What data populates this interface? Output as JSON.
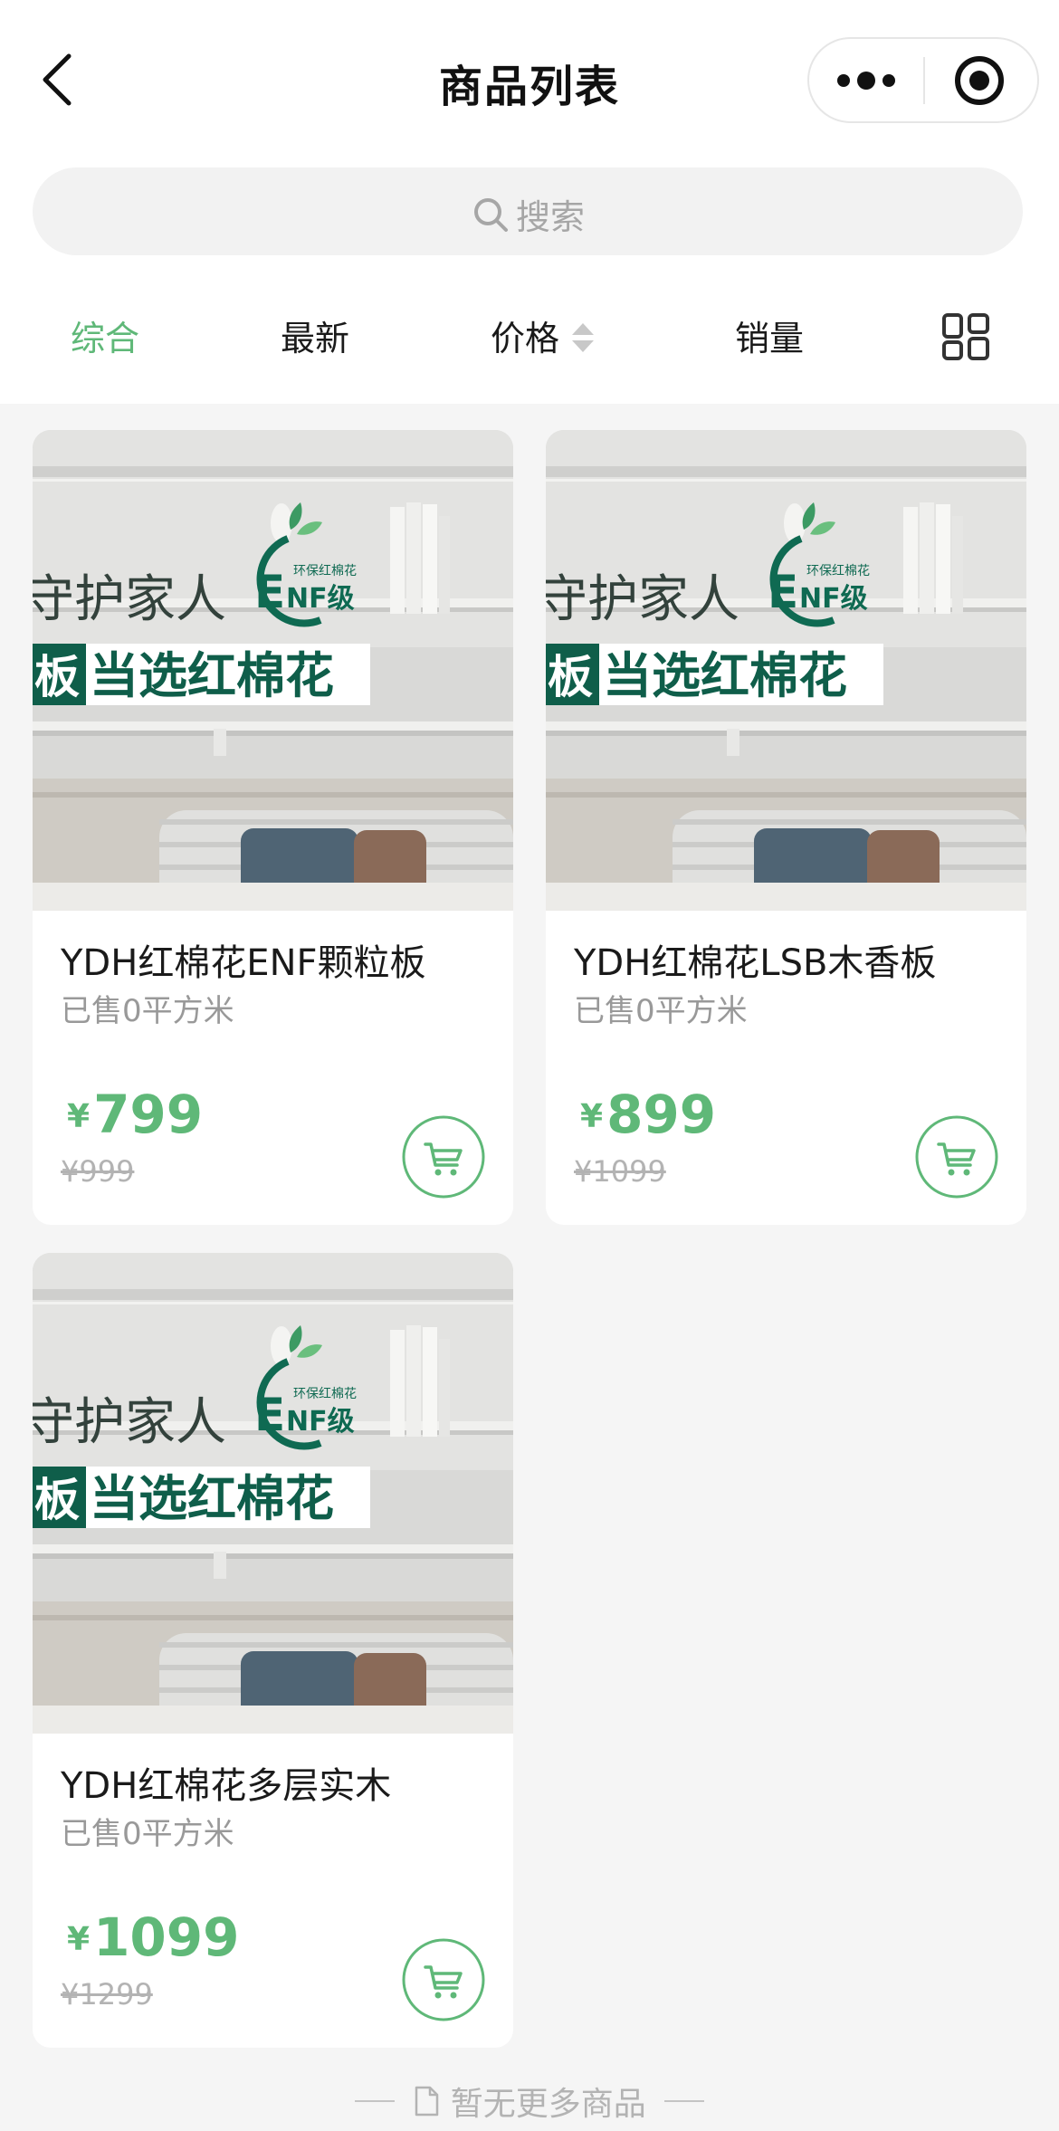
{
  "header": {
    "title": "商品列表",
    "back_icon": "chevron-left-icon",
    "more_icon": "more-dots-icon",
    "close_icon": "target-circle-icon"
  },
  "search": {
    "placeholder": "搜索",
    "icon": "search-icon"
  },
  "sort_tabs": [
    {
      "label": "综合",
      "active": true
    },
    {
      "label": "最新",
      "active": false
    },
    {
      "label": "价格",
      "active": false,
      "icon": "sort-arrows-icon"
    },
    {
      "label": "销量",
      "active": false
    }
  ],
  "layout_toggle_icon": "grid-view-icon",
  "accent_color": "#5fb878",
  "product_image": {
    "slogan_line1": "守护家人",
    "slogan_line2_prefix": "板",
    "slogan_line2": "当选红棉花",
    "badge_main": "ENF级",
    "badge_small": "环保红棉花"
  },
  "products": [
    {
      "name": "YDH红棉花ENF颗粒板",
      "sold": "已售0平方米",
      "currency": "¥",
      "price": "799",
      "original_price": "¥999",
      "cart_icon": "cart-icon"
    },
    {
      "name": "YDH红棉花LSB木香板",
      "sold": "已售0平方米",
      "currency": "¥",
      "price": "899",
      "original_price": "¥1099",
      "cart_icon": "cart-icon"
    },
    {
      "name": "YDH红棉花多层实木",
      "sold": "已售0平方米",
      "currency": "¥",
      "price": "1099",
      "original_price": "¥1299",
      "cart_icon": "cart-icon"
    }
  ],
  "footer": {
    "text": "暂无更多商品",
    "icon": "document-icon"
  }
}
